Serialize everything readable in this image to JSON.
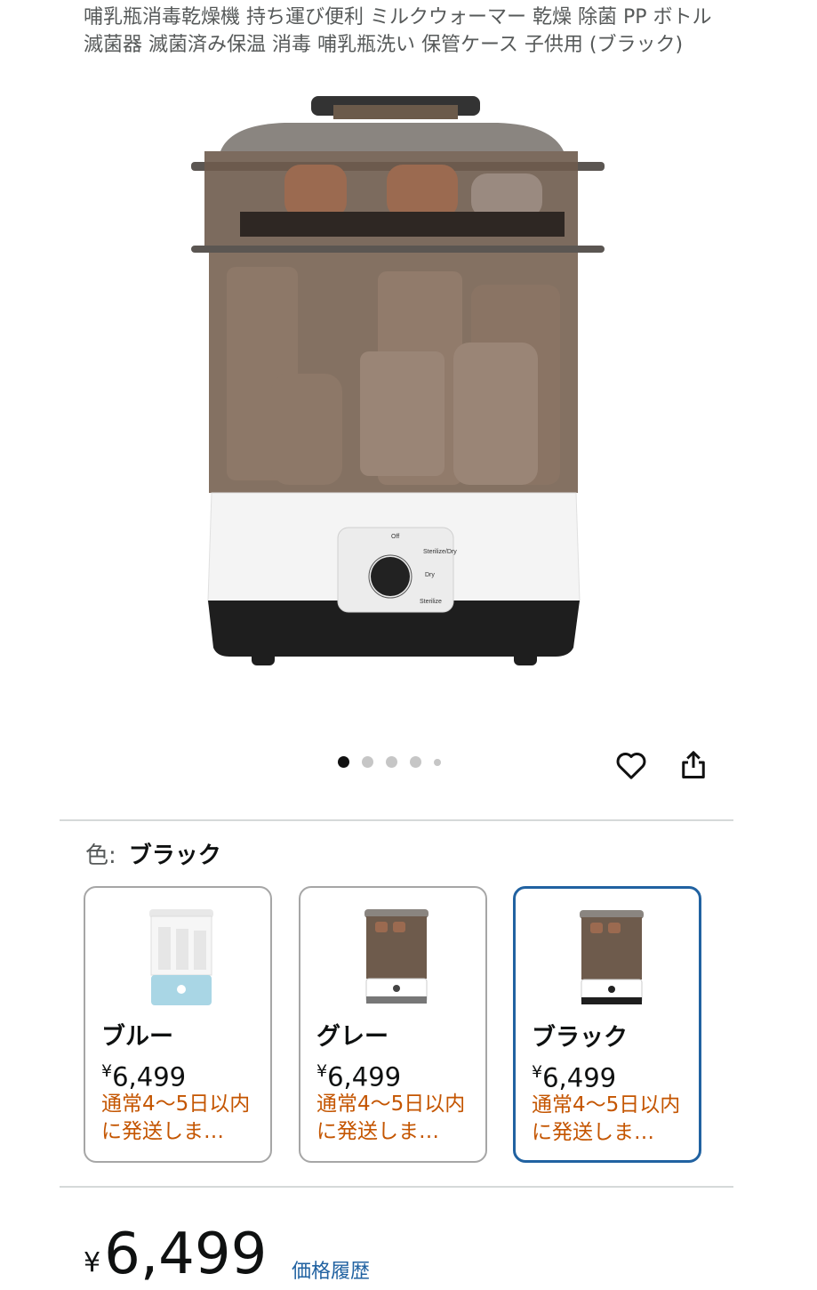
{
  "product": {
    "title": "哺乳瓶消毒乾燥機 持ち運び便利 ミルクウォーマー 乾燥 除菌 PP ボトル滅菌器 滅菌済み保温 消毒 哺乳瓶洗い 保管ケース 子供用 (ブラック)",
    "dial_labels": [
      "Off",
      "Sterilize/Dry",
      "Dry",
      "Sterilize"
    ]
  },
  "gallery": {
    "total_images": 5,
    "active_index": 0
  },
  "actions": {
    "wishlist_icon": "heart-icon",
    "share_icon": "share-icon"
  },
  "variation": {
    "label": "色:",
    "selected": "ブラック",
    "options": [
      {
        "name": "ブルー",
        "currency": "¥",
        "price": "6,499",
        "shipping": "通常4～5日以内に発送しま…",
        "base_color": "#a9d6e5",
        "selected": false
      },
      {
        "name": "グレー",
        "currency": "¥",
        "price": "6,499",
        "shipping": "通常4～5日以内に発送しま…",
        "base_color": "#ffffff",
        "selected": false
      },
      {
        "name": "ブラック",
        "currency": "¥",
        "price": "6,499",
        "shipping": "通常4～5日以内に発送しま…",
        "base_color": "#ffffff",
        "selected": true
      }
    ]
  },
  "price": {
    "currency": "¥",
    "value": "6,499",
    "history_link": "価格履歴"
  },
  "colors": {
    "link": "#2162a1",
    "shipping": "#c45500",
    "selected_border": "#2162a1"
  }
}
